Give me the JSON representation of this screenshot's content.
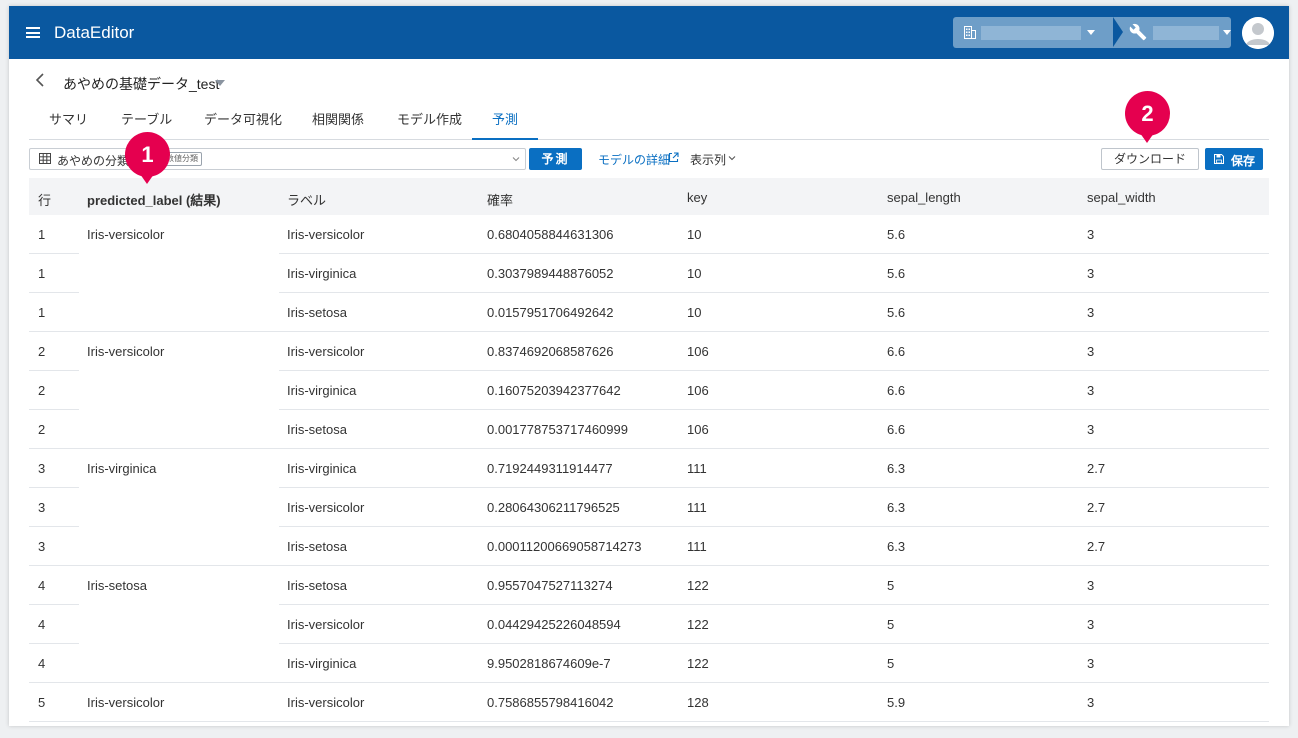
{
  "app": {
    "title": "DataEditor"
  },
  "dataset": {
    "title": "あやめの基礎データ_test"
  },
  "tabs": [
    {
      "label": "サマリ"
    },
    {
      "label": "テーブル"
    },
    {
      "label": "データ可視化"
    },
    {
      "label": "相関関係"
    },
    {
      "label": "モデル作成"
    },
    {
      "label": "予測"
    }
  ],
  "toolbar": {
    "model_name": "あやめの分類",
    "model_tag": "数値分類",
    "predict_label": "予測",
    "model_detail_label": "モデルの詳細",
    "columns_label": "表示列",
    "download_label": "ダウンロード",
    "save_label": "保存"
  },
  "annotations": {
    "badge1": "1",
    "badge2": "2",
    "color": "#e5004f"
  },
  "table": {
    "headers": [
      "行",
      "predicted_label (結果)",
      "ラベル",
      "確率",
      "key",
      "sepal_length",
      "sepal_width"
    ],
    "rows": [
      [
        "1",
        "Iris-versicolor",
        "Iris-versicolor",
        "0.6804058844631306",
        "10",
        "5.6",
        "3"
      ],
      [
        "1",
        "",
        "Iris-virginica",
        "0.3037989448876052",
        "10",
        "5.6",
        "3"
      ],
      [
        "1",
        "",
        "Iris-setosa",
        "0.0157951706492642",
        "10",
        "5.6",
        "3"
      ],
      [
        "2",
        "Iris-versicolor",
        "Iris-versicolor",
        "0.8374692068587626",
        "106",
        "6.6",
        "3"
      ],
      [
        "2",
        "",
        "Iris-virginica",
        "0.16075203942377642",
        "106",
        "6.6",
        "3"
      ],
      [
        "2",
        "",
        "Iris-setosa",
        "0.001778753717460999",
        "106",
        "6.6",
        "3"
      ],
      [
        "3",
        "Iris-virginica",
        "Iris-virginica",
        "0.7192449311914477",
        "111",
        "6.3",
        "2.7"
      ],
      [
        "3",
        "",
        "Iris-versicolor",
        "0.28064306211796525",
        "111",
        "6.3",
        "2.7"
      ],
      [
        "3",
        "",
        "Iris-setosa",
        "0.00011200669058714273",
        "111",
        "6.3",
        "2.7"
      ],
      [
        "4",
        "Iris-setosa",
        "Iris-setosa",
        "0.9557047527113274",
        "122",
        "5",
        "3"
      ],
      [
        "4",
        "",
        "Iris-versicolor",
        "0.04429425226048594",
        "122",
        "5",
        "3"
      ],
      [
        "4",
        "",
        "Iris-virginica",
        "9.9502818674609e-7",
        "122",
        "5",
        "3"
      ],
      [
        "5",
        "Iris-versicolor",
        "Iris-versicolor",
        "0.7586855798416042",
        "128",
        "5.9",
        "3"
      ]
    ]
  },
  "colors": {
    "appbar": "#0a58a0",
    "accent": "#0a6fc2"
  }
}
